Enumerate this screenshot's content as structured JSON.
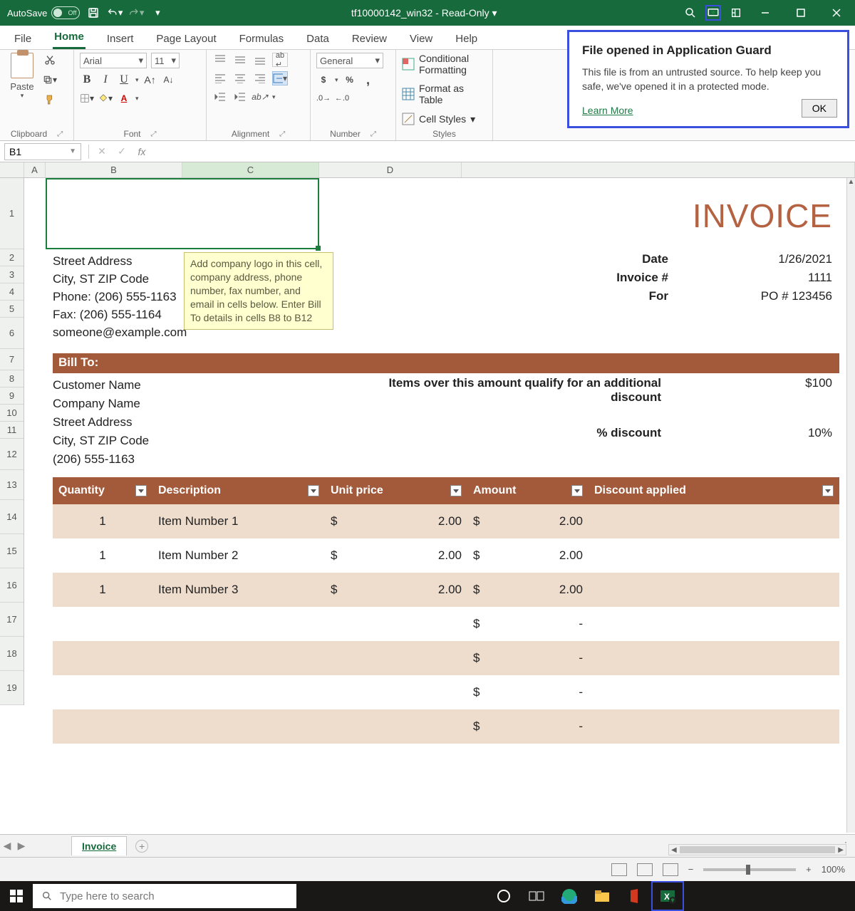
{
  "titlebar": {
    "autosave_label": "AutoSave",
    "autosave_state": "Off",
    "doc_title": "tf10000142_win32 - Read-Only ▾"
  },
  "tabs": [
    "File",
    "Home",
    "Insert",
    "Page Layout",
    "Formulas",
    "Data",
    "Review",
    "View",
    "Help"
  ],
  "active_tab": "Home",
  "ribbon": {
    "clipboard": {
      "paste": "Paste",
      "label": "Clipboard"
    },
    "font": {
      "name": "Arial",
      "size": "11",
      "label": "Font"
    },
    "alignment": {
      "label": "Alignment"
    },
    "number": {
      "format": "General",
      "label": "Number"
    },
    "styles": {
      "cond": "Conditional Formatting",
      "table": "Format as Table",
      "cell": "Cell Styles",
      "label": "Styles"
    }
  },
  "namebox": "B1",
  "colheads": {
    "a": "A",
    "b": "B",
    "c": "C",
    "d": "D"
  },
  "invoice": {
    "title": "INVOICE",
    "address": [
      "Street Address",
      "City, ST  ZIP Code",
      "Phone: (206) 555-1163",
      "Fax: (206) 555-1164",
      "someone@example.com"
    ],
    "tooltip": "Add company logo in this cell, company address, phone number, fax number, and email in cells below. Enter Bill To details in cells B8 to B12",
    "meta": {
      "date_l": "Date",
      "date_v": "1/26/2021",
      "inv_l": "Invoice #",
      "inv_v": "1111",
      "for_l": "For",
      "for_v": "PO # 123456"
    },
    "billto_label": "Bill To:",
    "billto": [
      "Customer Name",
      "Company Name",
      "Street Address",
      "City, ST  ZIP Code",
      "(206) 555-1163"
    ],
    "disc1_l": "Items over this amount qualify for an additional discount",
    "disc1_v": "$100",
    "disc2_l": "% discount",
    "disc2_v": "10%",
    "headers": {
      "q": "Quantity",
      "d": "Description",
      "u": "Unit price",
      "a": "Amount",
      "da": "Discount applied"
    },
    "items": [
      {
        "q": "1",
        "d": "Item Number 1",
        "uc": "$",
        "uv": "2.00",
        "ac": "$",
        "av": "2.00",
        "da": ""
      },
      {
        "q": "1",
        "d": "Item Number 2",
        "uc": "$",
        "uv": "2.00",
        "ac": "$",
        "av": "2.00",
        "da": ""
      },
      {
        "q": "1",
        "d": "Item Number 3",
        "uc": "$",
        "uv": "2.00",
        "ac": "$",
        "av": "2.00",
        "da": ""
      },
      {
        "q": "",
        "d": "",
        "uc": "",
        "uv": "",
        "ac": "$",
        "av": "-",
        "da": ""
      },
      {
        "q": "",
        "d": "",
        "uc": "",
        "uv": "",
        "ac": "$",
        "av": "-",
        "da": ""
      },
      {
        "q": "",
        "d": "",
        "uc": "",
        "uv": "",
        "ac": "$",
        "av": "-",
        "da": ""
      },
      {
        "q": "",
        "d": "",
        "uc": "",
        "uv": "",
        "ac": "$",
        "av": "-",
        "da": ""
      }
    ]
  },
  "sheet_tab": "Invoice",
  "zoom": "100%",
  "callout": {
    "title": "File opened in Application Guard",
    "body": "This file is from an untrusted source. To help keep you safe, we've opened it in a protected mode.",
    "link": "Learn More",
    "ok": "OK"
  },
  "taskbar": {
    "search_placeholder": "Type here to search"
  }
}
